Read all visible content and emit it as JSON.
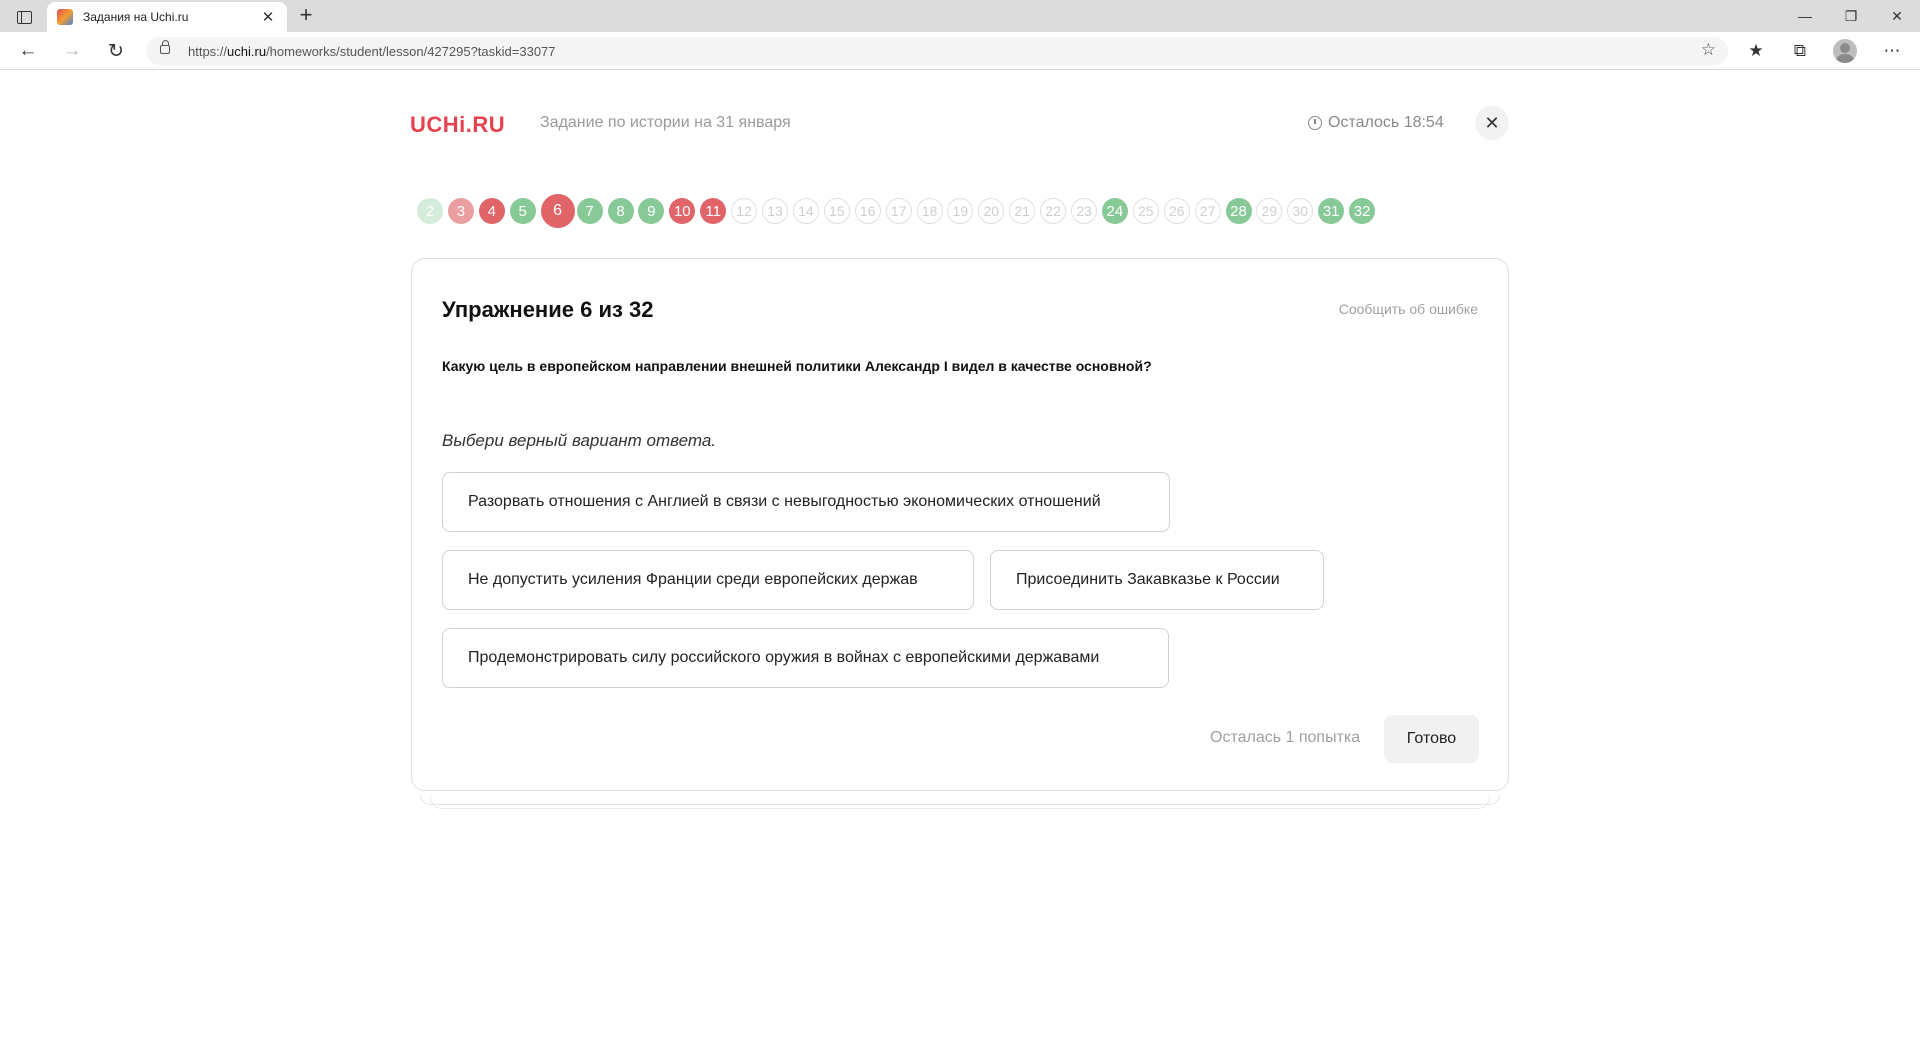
{
  "browser": {
    "tab_title": "Задания на Uchi.ru",
    "tab_close": "✕",
    "new_tab": "+",
    "url_prefix": "https://",
    "url_domain": "uchi.ru",
    "url_path": "/homeworks/student/lesson/427295?taskid=33077",
    "icons": [
      "tab-actions-icon",
      "back-icon",
      "forward-icon",
      "refresh-icon",
      "lock-icon",
      "add-favorite-icon",
      "favorites-icon",
      "collections-icon",
      "profile-icon",
      "more-icon",
      "minimize-icon",
      "restore-icon",
      "close-window-icon"
    ]
  },
  "header": {
    "logo": "UCHi.RU",
    "task_title": "Задание по истории на 31 января",
    "timer": "Осталось 18:54",
    "close_label": "✕"
  },
  "progress": {
    "items": [
      {
        "n": "2",
        "s": "gl"
      },
      {
        "n": "3",
        "s": "rl"
      },
      {
        "n": "4",
        "s": "r"
      },
      {
        "n": "5",
        "s": "g"
      },
      {
        "n": "6",
        "s": "cur"
      },
      {
        "n": "7",
        "s": "g"
      },
      {
        "n": "8",
        "s": "g"
      },
      {
        "n": "9",
        "s": "g"
      },
      {
        "n": "10",
        "s": "r"
      },
      {
        "n": "11",
        "s": "r"
      },
      {
        "n": "12",
        "s": "e"
      },
      {
        "n": "13",
        "s": "e"
      },
      {
        "n": "14",
        "s": "e"
      },
      {
        "n": "15",
        "s": "e"
      },
      {
        "n": "16",
        "s": "e"
      },
      {
        "n": "17",
        "s": "e"
      },
      {
        "n": "18",
        "s": "e"
      },
      {
        "n": "19",
        "s": "e"
      },
      {
        "n": "20",
        "s": "e"
      },
      {
        "n": "21",
        "s": "e"
      },
      {
        "n": "22",
        "s": "e"
      },
      {
        "n": "23",
        "s": "e"
      },
      {
        "n": "24",
        "s": "g"
      },
      {
        "n": "25",
        "s": "e"
      },
      {
        "n": "26",
        "s": "e"
      },
      {
        "n": "27",
        "s": "e"
      },
      {
        "n": "28",
        "s": "g"
      },
      {
        "n": "29",
        "s": "e"
      },
      {
        "n": "30",
        "s": "e"
      },
      {
        "n": "31",
        "s": "g"
      },
      {
        "n": "32",
        "s": "g"
      }
    ]
  },
  "exercise": {
    "title": "Упражнение 6 из 32",
    "report": "Сообщить об ошибке",
    "question": "Какую цель в европейском направлении внешней политики Александр I видел в качестве основной?",
    "hint": "Выбери верный вариант ответа.",
    "options": [
      "Разорвать отношения с Англией в связи с невыгодностью экономических отношений",
      "Не допустить усиления Франции среди европейских держав",
      "Присоединить Закавказье к России",
      "Продемонстрировать силу российского оружия в войнах с европейскими державами"
    ],
    "attempts": "Осталась 1 попытка",
    "done": "Готово"
  }
}
